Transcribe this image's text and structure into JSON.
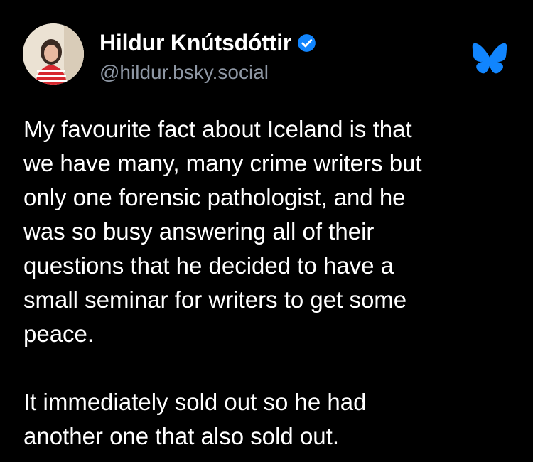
{
  "author": {
    "display_name": "Hildur Knútsdóttir",
    "handle": "@hildur.bsky.social",
    "avatar_icon": "profile-photo",
    "verified_icon": "verified-badge-icon"
  },
  "app": {
    "logo_icon": "bluesky-butterfly-icon"
  },
  "post": {
    "text": "My favourite fact about Iceland is that\nwe have many, many crime writers but\nonly one forensic pathologist, and he\nwas so busy answering all of their\nquestions that he decided to have a\nsmall seminar for writers to get some\npeace.\n\nIt immediately sold out so he had\nanother one that also sold out."
  },
  "colors": {
    "background": "#000000",
    "text": "#ffffff",
    "handle": "#8e97a4",
    "verified": "#1185fe",
    "logo": "#1185fe"
  }
}
